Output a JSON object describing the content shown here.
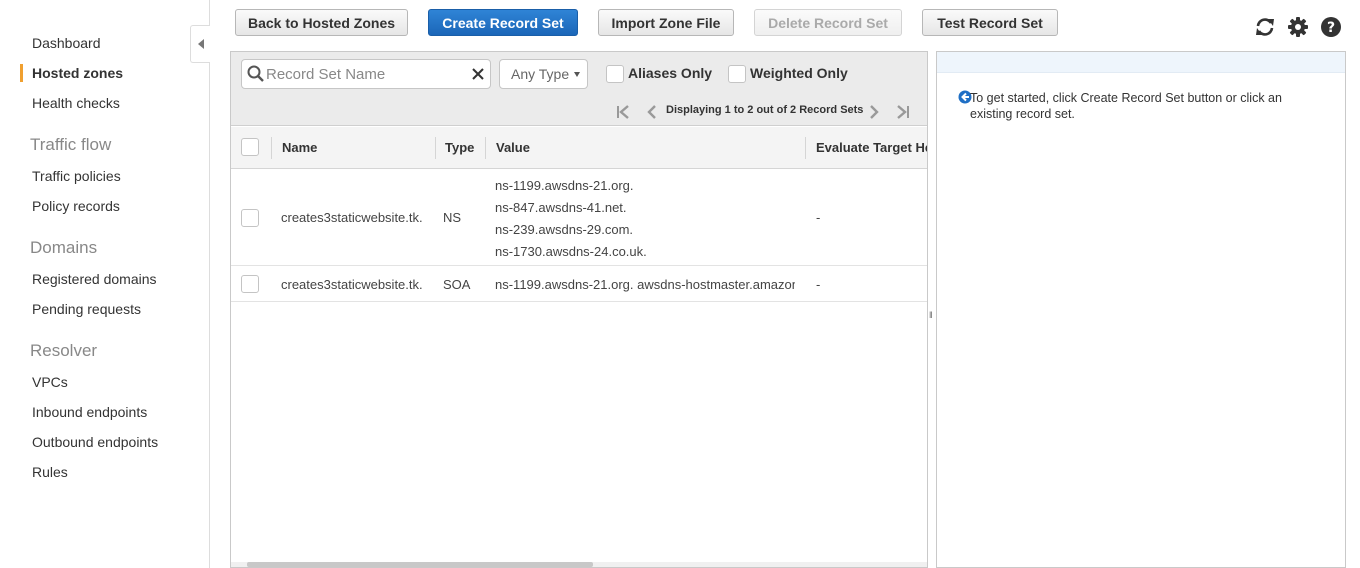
{
  "sidebar": {
    "items": [
      {
        "label": "Dashboard"
      },
      {
        "label": "Hosted zones"
      },
      {
        "label": "Health checks"
      }
    ],
    "traffic_flow": {
      "title": "Traffic flow",
      "items": [
        {
          "label": "Traffic policies"
        },
        {
          "label": "Policy records"
        }
      ]
    },
    "domains": {
      "title": "Domains",
      "items": [
        {
          "label": "Registered domains"
        },
        {
          "label": "Pending requests"
        }
      ]
    },
    "resolver": {
      "title": "Resolver",
      "items": [
        {
          "label": "VPCs"
        },
        {
          "label": "Inbound endpoints"
        },
        {
          "label": "Outbound endpoints"
        },
        {
          "label": "Rules"
        }
      ]
    },
    "active_item": "Hosted zones"
  },
  "toolbar": {
    "back_label": "Back to Hosted Zones",
    "create_label": "Create Record Set",
    "import_label": "Import Zone File",
    "delete_label": "Delete Record Set",
    "test_label": "Test Record Set"
  },
  "filters": {
    "search_placeholder": "Record Set Name",
    "type_value": "Any Type",
    "aliases_label": "Aliases Only",
    "weighted_label": "Weighted Only",
    "pager_text": "Displaying 1 to 2 out of 2 Record Sets"
  },
  "grid": {
    "columns": {
      "name": "Name",
      "type": "Type",
      "value": "Value",
      "evaluate": "Evaluate Target He"
    },
    "rows": [
      {
        "name": "creates3staticwebsite.tk.",
        "type": "NS",
        "values": [
          "ns-1199.awsdns-21.org.",
          "ns-847.awsdns-41.net.",
          "ns-239.awsdns-29.com.",
          "ns-1730.awsdns-24.co.uk."
        ],
        "evaluate": "-"
      },
      {
        "name": "creates3staticwebsite.tk.",
        "type": "SOA",
        "values": [
          "ns-1199.awsdns-21.org. awsdns-hostmaster.amazon"
        ],
        "evaluate": "-"
      }
    ]
  },
  "help": {
    "text": "To get started, click Create Record Set button or click an existing record set."
  },
  "icons": {
    "refresh": "refresh-icon",
    "settings": "gear-icon",
    "help": "help-icon",
    "accent": "#f0a030",
    "primary": "#1f6fc5"
  }
}
